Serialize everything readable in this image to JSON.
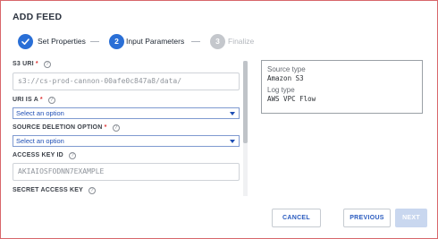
{
  "dialog": {
    "title": "ADD FEED"
  },
  "stepper": {
    "steps": [
      {
        "label": "Set Properties",
        "number": "1",
        "state": "done"
      },
      {
        "label": "Input Parameters",
        "number": "2",
        "state": "active"
      },
      {
        "label": "Finalize",
        "number": "3",
        "state": "pending"
      }
    ]
  },
  "form": {
    "s3_uri": {
      "label": "S3 URI",
      "required": "*",
      "value": "s3://cs-prod-cannon-00afe0c847a8/data/"
    },
    "uri_is_a": {
      "label": "URI IS A",
      "required": "*",
      "selected": "Select an option"
    },
    "source_deletion": {
      "label": "SOURCE DELETION OPTION",
      "required": "*",
      "selected": "Select an option"
    },
    "access_key": {
      "label": "ACCESS KEY ID",
      "placeholder": "AKIAIOSFODNN7EXAMPLE"
    },
    "secret_key": {
      "label": "SECRET ACCESS KEY"
    }
  },
  "info": {
    "source_type_label": "Source type",
    "source_type_value": "Amazon S3",
    "log_type_label": "Log type",
    "log_type_value": "AWS VPC Flow"
  },
  "buttons": {
    "cancel": "CANCEL",
    "previous": "PREVIOUS",
    "next": "NEXT"
  },
  "colors": {
    "accent": "#2a6fd6",
    "pending": "#c4c7cc",
    "frame_border": "#d8666b",
    "select_text": "#1f4fb5"
  },
  "icons": {
    "check": "check-icon",
    "help": "help-circle-icon",
    "caret": "caret-down-icon"
  }
}
